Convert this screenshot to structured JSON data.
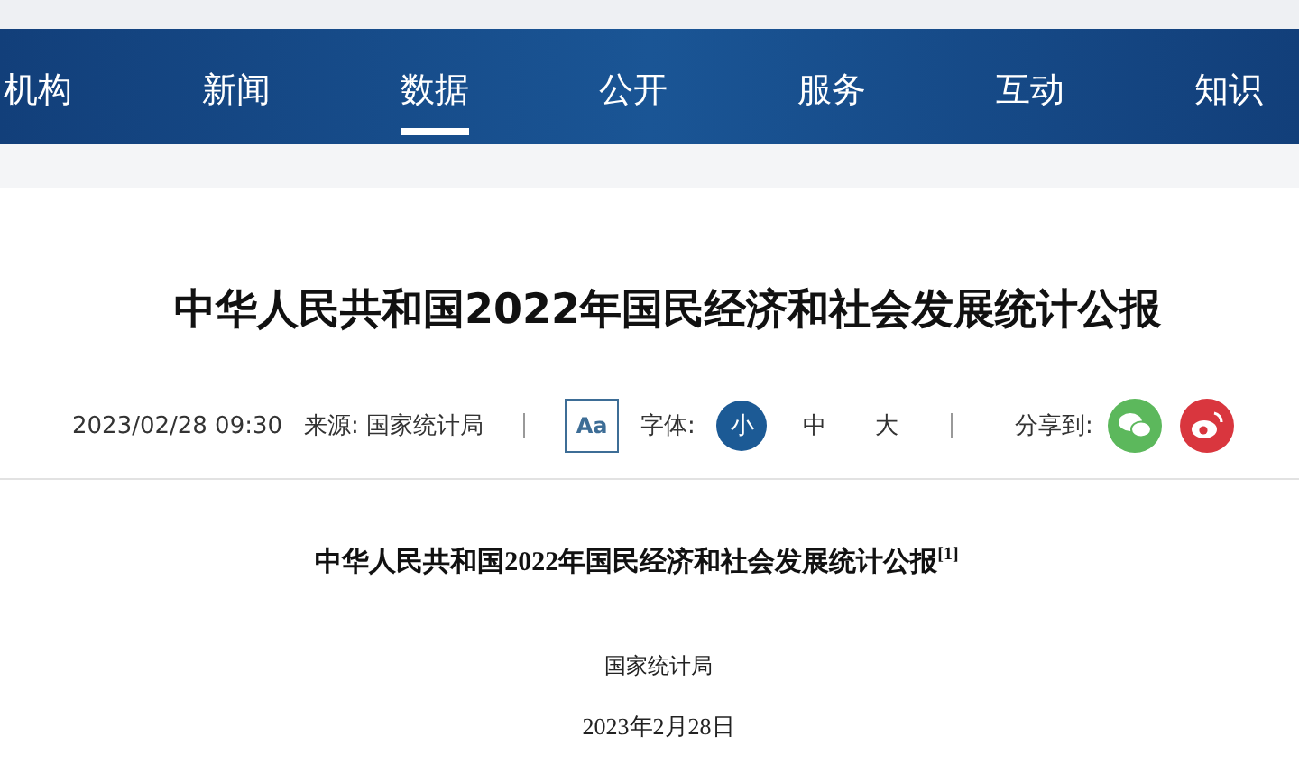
{
  "nav": {
    "items": [
      {
        "label": "机构",
        "selected": false
      },
      {
        "label": "新闻",
        "selected": false
      },
      {
        "label": "数据",
        "selected": true
      },
      {
        "label": "公开",
        "selected": false
      },
      {
        "label": "服务",
        "selected": false
      },
      {
        "label": "互动",
        "selected": false
      },
      {
        "label": "知识",
        "selected": false
      }
    ]
  },
  "article": {
    "title": "中华人民共和国2022年国民经济和社会发展统计公报",
    "date": "2023/02/28 09:30",
    "source": "来源: 国家统计局",
    "font_icon": "Aa",
    "font_label": "字体:",
    "font_sizes": [
      {
        "label": "小",
        "selected": true
      },
      {
        "label": "中",
        "selected": false
      },
      {
        "label": "大",
        "selected": false
      }
    ],
    "share_label": "分享到:"
  },
  "document": {
    "title": "中华人民共和国2022年国民经济和社会发展统计公报$^{[1]}$",
    "author": "国家统计局",
    "date": "2023年2月28日"
  }
}
